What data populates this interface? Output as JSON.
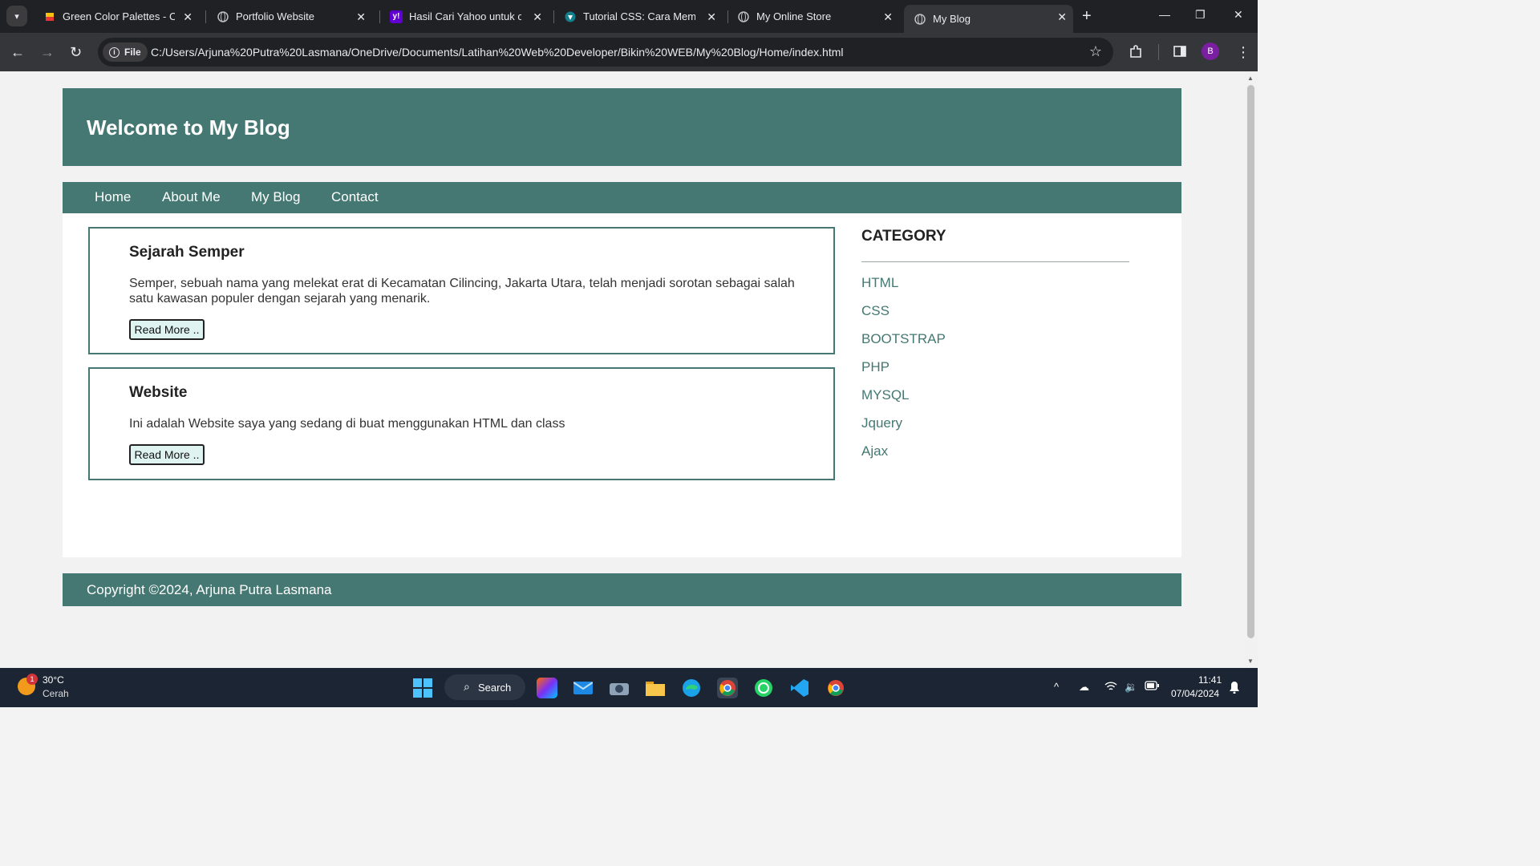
{
  "browser": {
    "tabs": [
      {
        "title": "Green Color Palettes - Colo",
        "icon": "palette-icon"
      },
      {
        "title": "Portfolio Website",
        "icon": "globe-icon"
      },
      {
        "title": "Hasil Cari Yahoo untuk cara",
        "icon": "yahoo-icon"
      },
      {
        "title": "Tutorial CSS: Cara Membua",
        "icon": "tutorial-icon"
      },
      {
        "title": "My Online Store",
        "icon": "globe-icon"
      },
      {
        "title": "My Blog",
        "icon": "globe-icon"
      }
    ],
    "active_tab": 5,
    "site_chip": "File",
    "url": "C:/Users/Arjuna%20Putra%20Lasmana/OneDrive/Documents/Latihan%20Web%20Developer/Bikin%20WEB/My%20Blog/Home/index.html",
    "profile_initial": "B"
  },
  "page": {
    "header_title": "Welcome to My Blog",
    "nav": [
      "Home",
      "About Me",
      "My Blog",
      "Contact"
    ],
    "posts": [
      {
        "title": "Sejarah Semper",
        "body": "Semper, sebuah nama yang melekat erat di Kecamatan Cilincing, Jakarta Utara, telah menjadi sorotan sebagai salah satu kawasan populer dengan sejarah yang menarik.",
        "button": "Read More .."
      },
      {
        "title": "Website",
        "body": "Ini adalah Website saya yang sedang di buat menggunakan HTML dan class",
        "button": "Read More .."
      }
    ],
    "category": {
      "heading": "CATEGORY",
      "items": [
        "HTML",
        "CSS",
        "BOOTSTRAP",
        "PHP",
        "MYSQL",
        "Jquery",
        "Ajax"
      ]
    },
    "footer": "Copyright ©2024, Arjuna Putra Lasmana",
    "colors": {
      "primary": "#457872",
      "button_bg": "#dff3f0"
    }
  },
  "taskbar": {
    "weather": {
      "temp": "30°C",
      "desc": "Cerah",
      "badge": "1"
    },
    "search_label": "Search",
    "clock": {
      "time": "11:41",
      "date": "07/04/2024"
    }
  }
}
